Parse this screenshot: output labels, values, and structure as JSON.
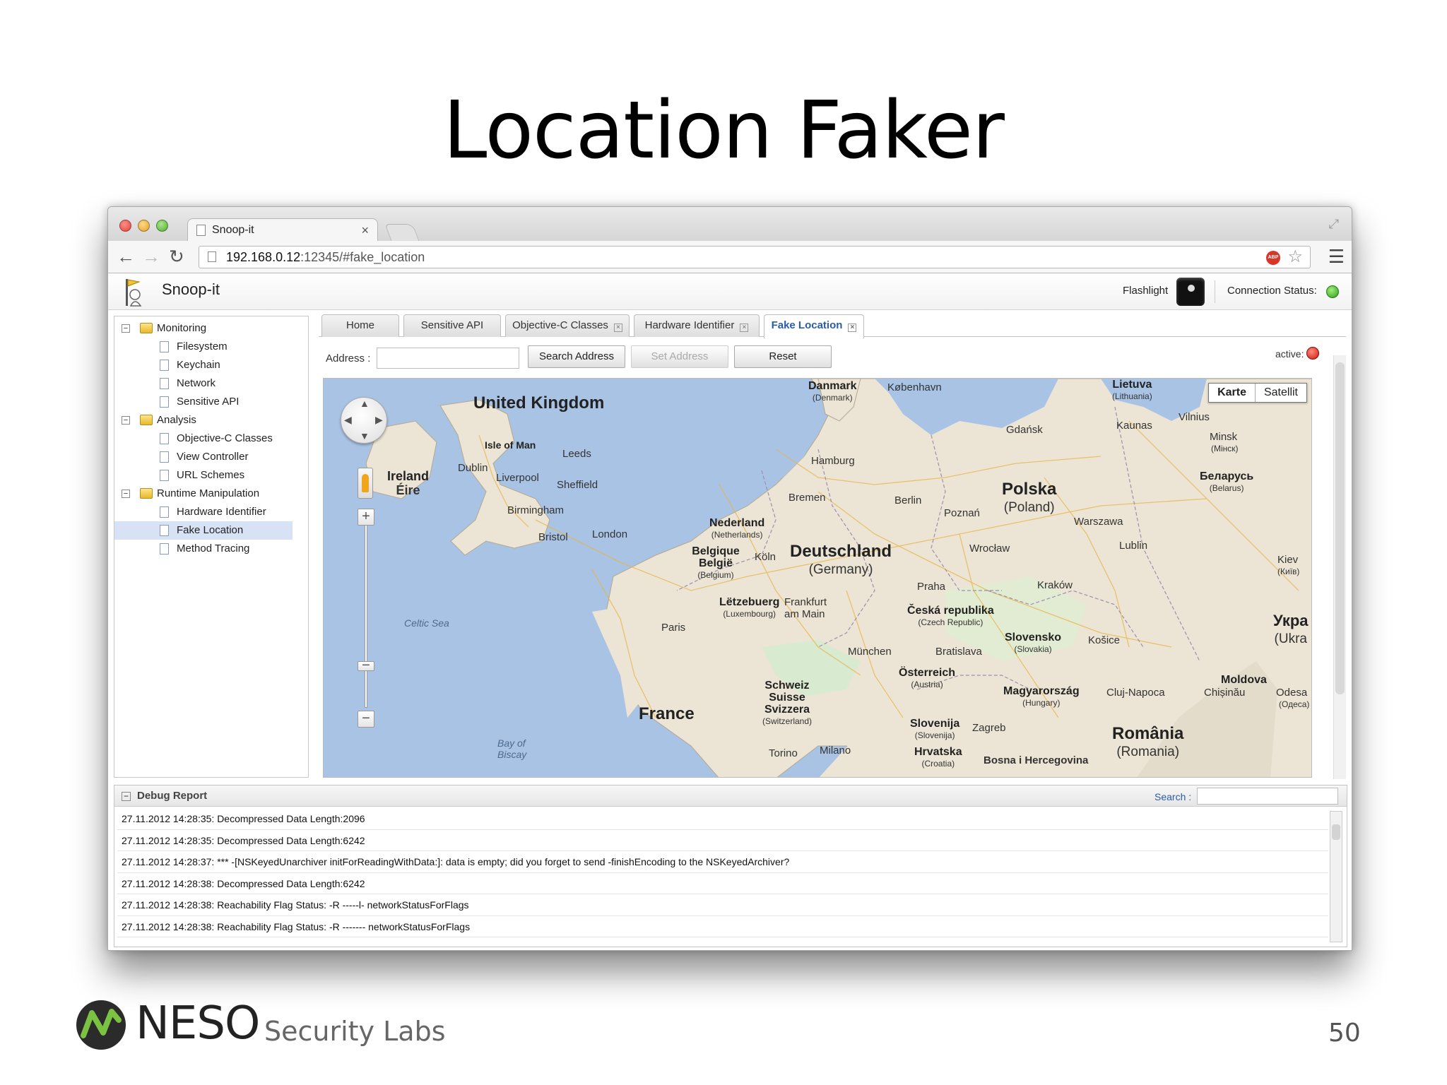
{
  "slide": {
    "title": "Location Faker",
    "brand": "NESO",
    "brand_sub": "Security Labs",
    "page_number": "50"
  },
  "browser": {
    "tab_title": "Snoop-it",
    "tab_close": "×",
    "url_host": "192.168.0.12",
    "url_rest": ":12345/#fake_location",
    "adblock_label": "ABP",
    "icons": [
      "back-arrow-icon",
      "forward-arrow-icon",
      "reload-icon",
      "page-icon",
      "adblock-icon",
      "star-icon",
      "menu-icon"
    ]
  },
  "app": {
    "title": "Snoop-it",
    "flashlight_label": "Flashlight",
    "connection_label": "Connection Status:",
    "connection_color": "#2f9a1a"
  },
  "sidebar": {
    "groups": [
      {
        "label": "Monitoring",
        "expanded": true,
        "items": [
          "Filesystem",
          "Keychain",
          "Network",
          "Sensitive API"
        ]
      },
      {
        "label": "Analysis",
        "expanded": true,
        "items": [
          "Objective-C Classes",
          "View Controller",
          "URL Schemes"
        ]
      },
      {
        "label": "Runtime Manipulation",
        "expanded": true,
        "items": [
          "Hardware Identifier",
          "Fake Location",
          "Method Tracing"
        ]
      }
    ],
    "selected": "Fake Location"
  },
  "tabs": [
    {
      "label": "Home",
      "closable": false
    },
    {
      "label": "Sensitive API",
      "closable": false
    },
    {
      "label": "Objective-C Classes",
      "closable": true
    },
    {
      "label": "Hardware Identifier",
      "closable": true
    },
    {
      "label": "Fake Location",
      "closable": true,
      "active": true
    }
  ],
  "location_form": {
    "address_label": "Address :",
    "address_value": "",
    "search_button": "Search Address",
    "set_button": "Set Address",
    "reset_button": "Reset",
    "active_label": "active:",
    "active_color": "#cc1a10"
  },
  "map": {
    "type_options": [
      "Karte",
      "Satellit"
    ],
    "selected_type": "Karte",
    "zoom_in": "+",
    "zoom_out": "−",
    "countries": [
      {
        "name": "United Kingdom"
      },
      {
        "name": "Ireland",
        "sub": "Éire"
      },
      {
        "name": "Deutschland",
        "sub": "(Germany)"
      },
      {
        "name": "Polska",
        "sub": "(Poland)"
      },
      {
        "name": "France"
      },
      {
        "name": "România",
        "sub": "(Romania)"
      },
      {
        "name": "Nederland",
        "sub": "(Netherlands)"
      },
      {
        "name": "Belgique België",
        "sub": "(Belgium)"
      },
      {
        "name": "Lëtzebuerg",
        "sub": "(Luxembourg)"
      },
      {
        "name": "Česká republika",
        "sub": "(Czech Republic)"
      },
      {
        "name": "Slovensko",
        "sub": "(Slovakia)"
      },
      {
        "name": "Österreich",
        "sub": "(Austria)"
      },
      {
        "name": "Magyarország",
        "sub": "(Hungary)"
      },
      {
        "name": "Schweiz Suisse Svizzera",
        "sub": "(Switzerland)"
      },
      {
        "name": "Slovenija",
        "sub": "(Slovenija)"
      },
      {
        "name": "Hrvatska",
        "sub": "(Croatia)"
      },
      {
        "name": "Danmark",
        "sub": "(Denmark)"
      },
      {
        "name": "Lietuva",
        "sub": "(Lithuania)"
      },
      {
        "name": "Беларусь",
        "sub": "(Belarus)"
      },
      {
        "name": "Moldova"
      },
      {
        "name": "Укра",
        "sub": "(Ukra"
      },
      {
        "name": "Isle of Man"
      }
    ],
    "cities": [
      "København",
      "Gdańsk",
      "Kaunas",
      "Vilnius",
      "Minsk",
      "(Мінск)",
      "Hamburg",
      "Bremen",
      "Berlin",
      "Poznań",
      "Warszawa",
      "Dublin",
      "Liverpool",
      "Leeds",
      "Sheffield",
      "Birmingham",
      "Bristol",
      "London",
      "Köln",
      "Frankfurt am Main",
      "Wrocław",
      "Lublin",
      "Kiev",
      "(Київ)",
      "Praha",
      "Kraków",
      "Paris",
      "München",
      "Bratislava",
      "Košice",
      "Cluj-Napoca",
      "Chișinău",
      "Odesa",
      "(Одеса)",
      "Zagreb",
      "Torino",
      "Milano",
      "Bosna i Hercegovina"
    ],
    "seas": [
      "Celtic Sea",
      "Bay of Biscay"
    ]
  },
  "debug": {
    "title": "Debug Report",
    "search_label": "Search :",
    "search_value": "",
    "entries": [
      "27.11.2012 14:28:35: Decompressed Data Length:2096",
      "27.11.2012 14:28:35: Decompressed Data Length:6242",
      "27.11.2012 14:28:37: *** -[NSKeyedUnarchiver initForReadingWithData:]: data is empty; did you forget to send -finishEncoding to the NSKeyedArchiver?",
      "27.11.2012 14:28:38: Decompressed Data Length:6242",
      "27.11.2012 14:28:38: Reachability Flag Status: -R -----l- networkStatusForFlags",
      "27.11.2012 14:28:38: Reachability Flag Status: -R ------- networkStatusForFlags"
    ]
  }
}
